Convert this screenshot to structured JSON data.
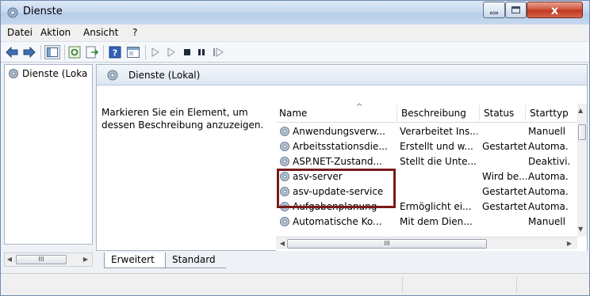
{
  "window": {
    "title": "Dienste",
    "controls": {
      "minimize": "minimize",
      "maximize": "maximize",
      "close": "x"
    }
  },
  "menu": {
    "items": [
      {
        "label": "Datei"
      },
      {
        "label": "Aktion"
      },
      {
        "label": "Ansicht"
      },
      {
        "label": "?"
      }
    ]
  },
  "toolbar": {
    "buttons": [
      {
        "icon": "back-arrow-icon"
      },
      {
        "icon": "forward-arrow-icon"
      },
      {
        "icon": "console-tree-icon"
      },
      {
        "icon": "refresh-icon"
      },
      {
        "icon": "export-list-icon"
      },
      {
        "icon": "help-icon"
      },
      {
        "icon": "properties-icon"
      },
      {
        "icon": "start-service-icon"
      },
      {
        "icon": "start-service-2-icon"
      },
      {
        "icon": "stop-service-icon"
      },
      {
        "icon": "pause-service-icon"
      },
      {
        "icon": "restart-service-icon"
      }
    ]
  },
  "tree": {
    "item": "Dienste (Loka",
    "scroll_thumb": "III"
  },
  "pane": {
    "header": "Dienste (Lokal)",
    "description": "Markieren Sie ein Element, um dessen Beschreibung anzuzeigen."
  },
  "list": {
    "columns": {
      "name": "Name",
      "description": "Beschreibung",
      "status": "Status",
      "startup": "Starttyp"
    },
    "rows": [
      {
        "name": "Anwendungsverw...",
        "description": "Verarbeitet Ins...",
        "status": "",
        "startup": "Manuell"
      },
      {
        "name": "Arbeitsstationsdie...",
        "description": "Erstellt und w...",
        "status": "Gestartet",
        "startup": "Automa."
      },
      {
        "name": "ASP.NET-Zustand...",
        "description": "Stellt die Unte...",
        "status": "",
        "startup": "Deaktivi."
      },
      {
        "name": "asv-server",
        "description": "",
        "status": "Wird be...",
        "startup": "Automa."
      },
      {
        "name": "asv-update-service",
        "description": "",
        "status": "Gestartet",
        "startup": "Automa."
      },
      {
        "name": "Aufgabenplanung",
        "description": "Ermöglicht ei...",
        "status": "Gestartet",
        "startup": "Automa."
      },
      {
        "name": "Automatische Ko...",
        "description": "Mit dem Dien...",
        "status": "",
        "startup": "Manuell"
      }
    ],
    "scroll_thumb": "III"
  },
  "tabs": [
    {
      "label": "Erweitert"
    },
    {
      "label": "Standard"
    }
  ],
  "colors": {
    "highlight_box": "#7a1a1a",
    "title_gradient": "#c7d9ef",
    "close_button": "#c0391f"
  }
}
